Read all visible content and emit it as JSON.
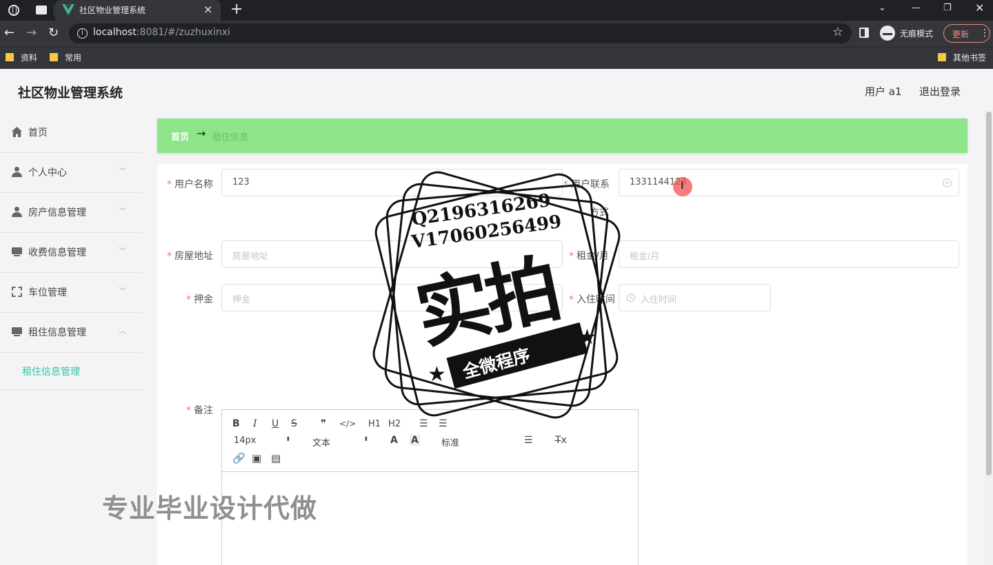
{
  "browser": {
    "tab_title": "社区物业管理系统",
    "url_host": "localhost",
    "url_rest": ":8081/#/zuzhuxinxi",
    "incognito_label": "无痕模式",
    "update_label": "更新",
    "bookmarks": [
      "资料",
      "常用"
    ],
    "other_bookmarks": "其他书签"
  },
  "header": {
    "title": "社区物业管理系统",
    "user": "用户 a1",
    "logout": "退出登录"
  },
  "sidebar": {
    "items": [
      {
        "label": "首页",
        "icon": "home-icon"
      },
      {
        "label": "个人中心",
        "icon": "user-icon"
      },
      {
        "label": "房产信息管理",
        "icon": "user-icon"
      },
      {
        "label": "收费信息管理",
        "icon": "monitor-icon"
      },
      {
        "label": "车位管理",
        "icon": "frame-icon"
      },
      {
        "label": "租住信息管理",
        "icon": "monitor-icon"
      }
    ],
    "submenu": "租住信息管理"
  },
  "breadcrumb": {
    "home": "首页",
    "arrow": "→",
    "current": "租住信息"
  },
  "form": {
    "username_label": "用户名称",
    "username_value": "123",
    "contact_label_1": "用户联系",
    "contact_label_2": "方式",
    "contact_value": "1331144123",
    "address_label": "房屋地址",
    "address_placeholder": "房屋地址",
    "rent_label": "租金/月",
    "rent_placeholder": "租金/月",
    "deposit_label": "押金",
    "deposit_placeholder": "押金",
    "checkin_label": "入住时间",
    "checkin_placeholder": "入住时间",
    "remark_label": "备注"
  },
  "editor": {
    "bold": "B",
    "italic": "I",
    "underline": "U",
    "strike": "S",
    "quote": "❞",
    "code": "</>",
    "h1": "H1",
    "h2": "H2",
    "ol": "☰",
    "ul": "☰",
    "font_size": "14px",
    "font_type": "文本",
    "color": "A",
    "background": "A",
    "header": "标准",
    "align": "☰",
    "clean": "T̶x"
  },
  "overlay": {
    "stamp_line1": "Q2196316269",
    "stamp_line2": "V17060256499",
    "stamp_main": "实拍",
    "stamp_ribbon": "全微程序",
    "watermark": "专业毕业设计代做"
  }
}
